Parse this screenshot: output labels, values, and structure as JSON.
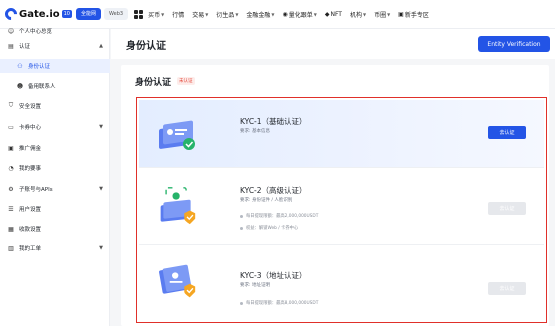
{
  "topnav": {
    "logo_text": "Gate.io",
    "logo_badge": "10",
    "pill_active": "全能网",
    "pill_plain": "Web3",
    "menu": [
      {
        "label": "买币",
        "caret": true
      },
      {
        "label": "行情",
        "caret": false
      },
      {
        "label": "交易",
        "caret": true
      },
      {
        "label": "衍生品",
        "caret": true
      },
      {
        "label": "金融金融",
        "caret": true
      },
      {
        "label": "量化跟单",
        "caret": true
      },
      {
        "label": "NFT",
        "caret": false
      },
      {
        "label": "机构",
        "caret": true
      },
      {
        "label": "币圈",
        "caret": true
      },
      {
        "label": "新手专区",
        "caret": false
      }
    ]
  },
  "sidebar": {
    "items": [
      {
        "label": "个人中心总览",
        "icon": "user-icon"
      },
      {
        "label": "认证",
        "icon": "id-card-icon",
        "arrow": "^"
      },
      {
        "label": "身份认证",
        "icon": "verify-icon"
      },
      {
        "label": "备用联系人",
        "icon": "contact-icon"
      },
      {
        "label": "安全设置",
        "icon": "shield-icon"
      },
      {
        "label": "卡券中心",
        "icon": "ticket-icon",
        "arrow": "v"
      },
      {
        "label": "推广佣金",
        "icon": "commission-icon"
      },
      {
        "label": "我的要事",
        "icon": "bell-icon"
      },
      {
        "label": "子账号与APIs",
        "icon": "api-icon",
        "arrow": "v"
      },
      {
        "label": "用户设置",
        "icon": "settings-icon"
      },
      {
        "label": "收款设置",
        "icon": "wallet-icon"
      },
      {
        "label": "我的工单",
        "icon": "ticket-list-icon",
        "arrow": "v"
      }
    ]
  },
  "header": {
    "title": "身份认证",
    "entity_button": "Entity Verification"
  },
  "main": {
    "section_title": "身份认证",
    "tag": "未认证",
    "kyc": [
      {
        "name": "KYC-1（基础认证）",
        "requirement": "要求: 基本信息",
        "limits": [],
        "button": "去认证",
        "button_state": "primary"
      },
      {
        "name": "KYC-2（高级认证）",
        "requirement": "要求: 身份证件 / 人脸识别",
        "limits": [
          "每日提现限额：最高2,000,000USDT",
          "权益：解锁Web / 卡券中心"
        ],
        "button": "去认证",
        "button_state": "disabled"
      },
      {
        "name": "KYC-3（地址认证）",
        "requirement": "要求: 地址证明",
        "limits": [
          "每日提现限额：最高8,000,000USDT"
        ],
        "button": "去认证",
        "button_state": "disabled"
      }
    ]
  },
  "colors": {
    "brand": "#2354e6",
    "highlight_border": "#e0302a",
    "success": "#26b36a",
    "warning": "#f5a623"
  }
}
